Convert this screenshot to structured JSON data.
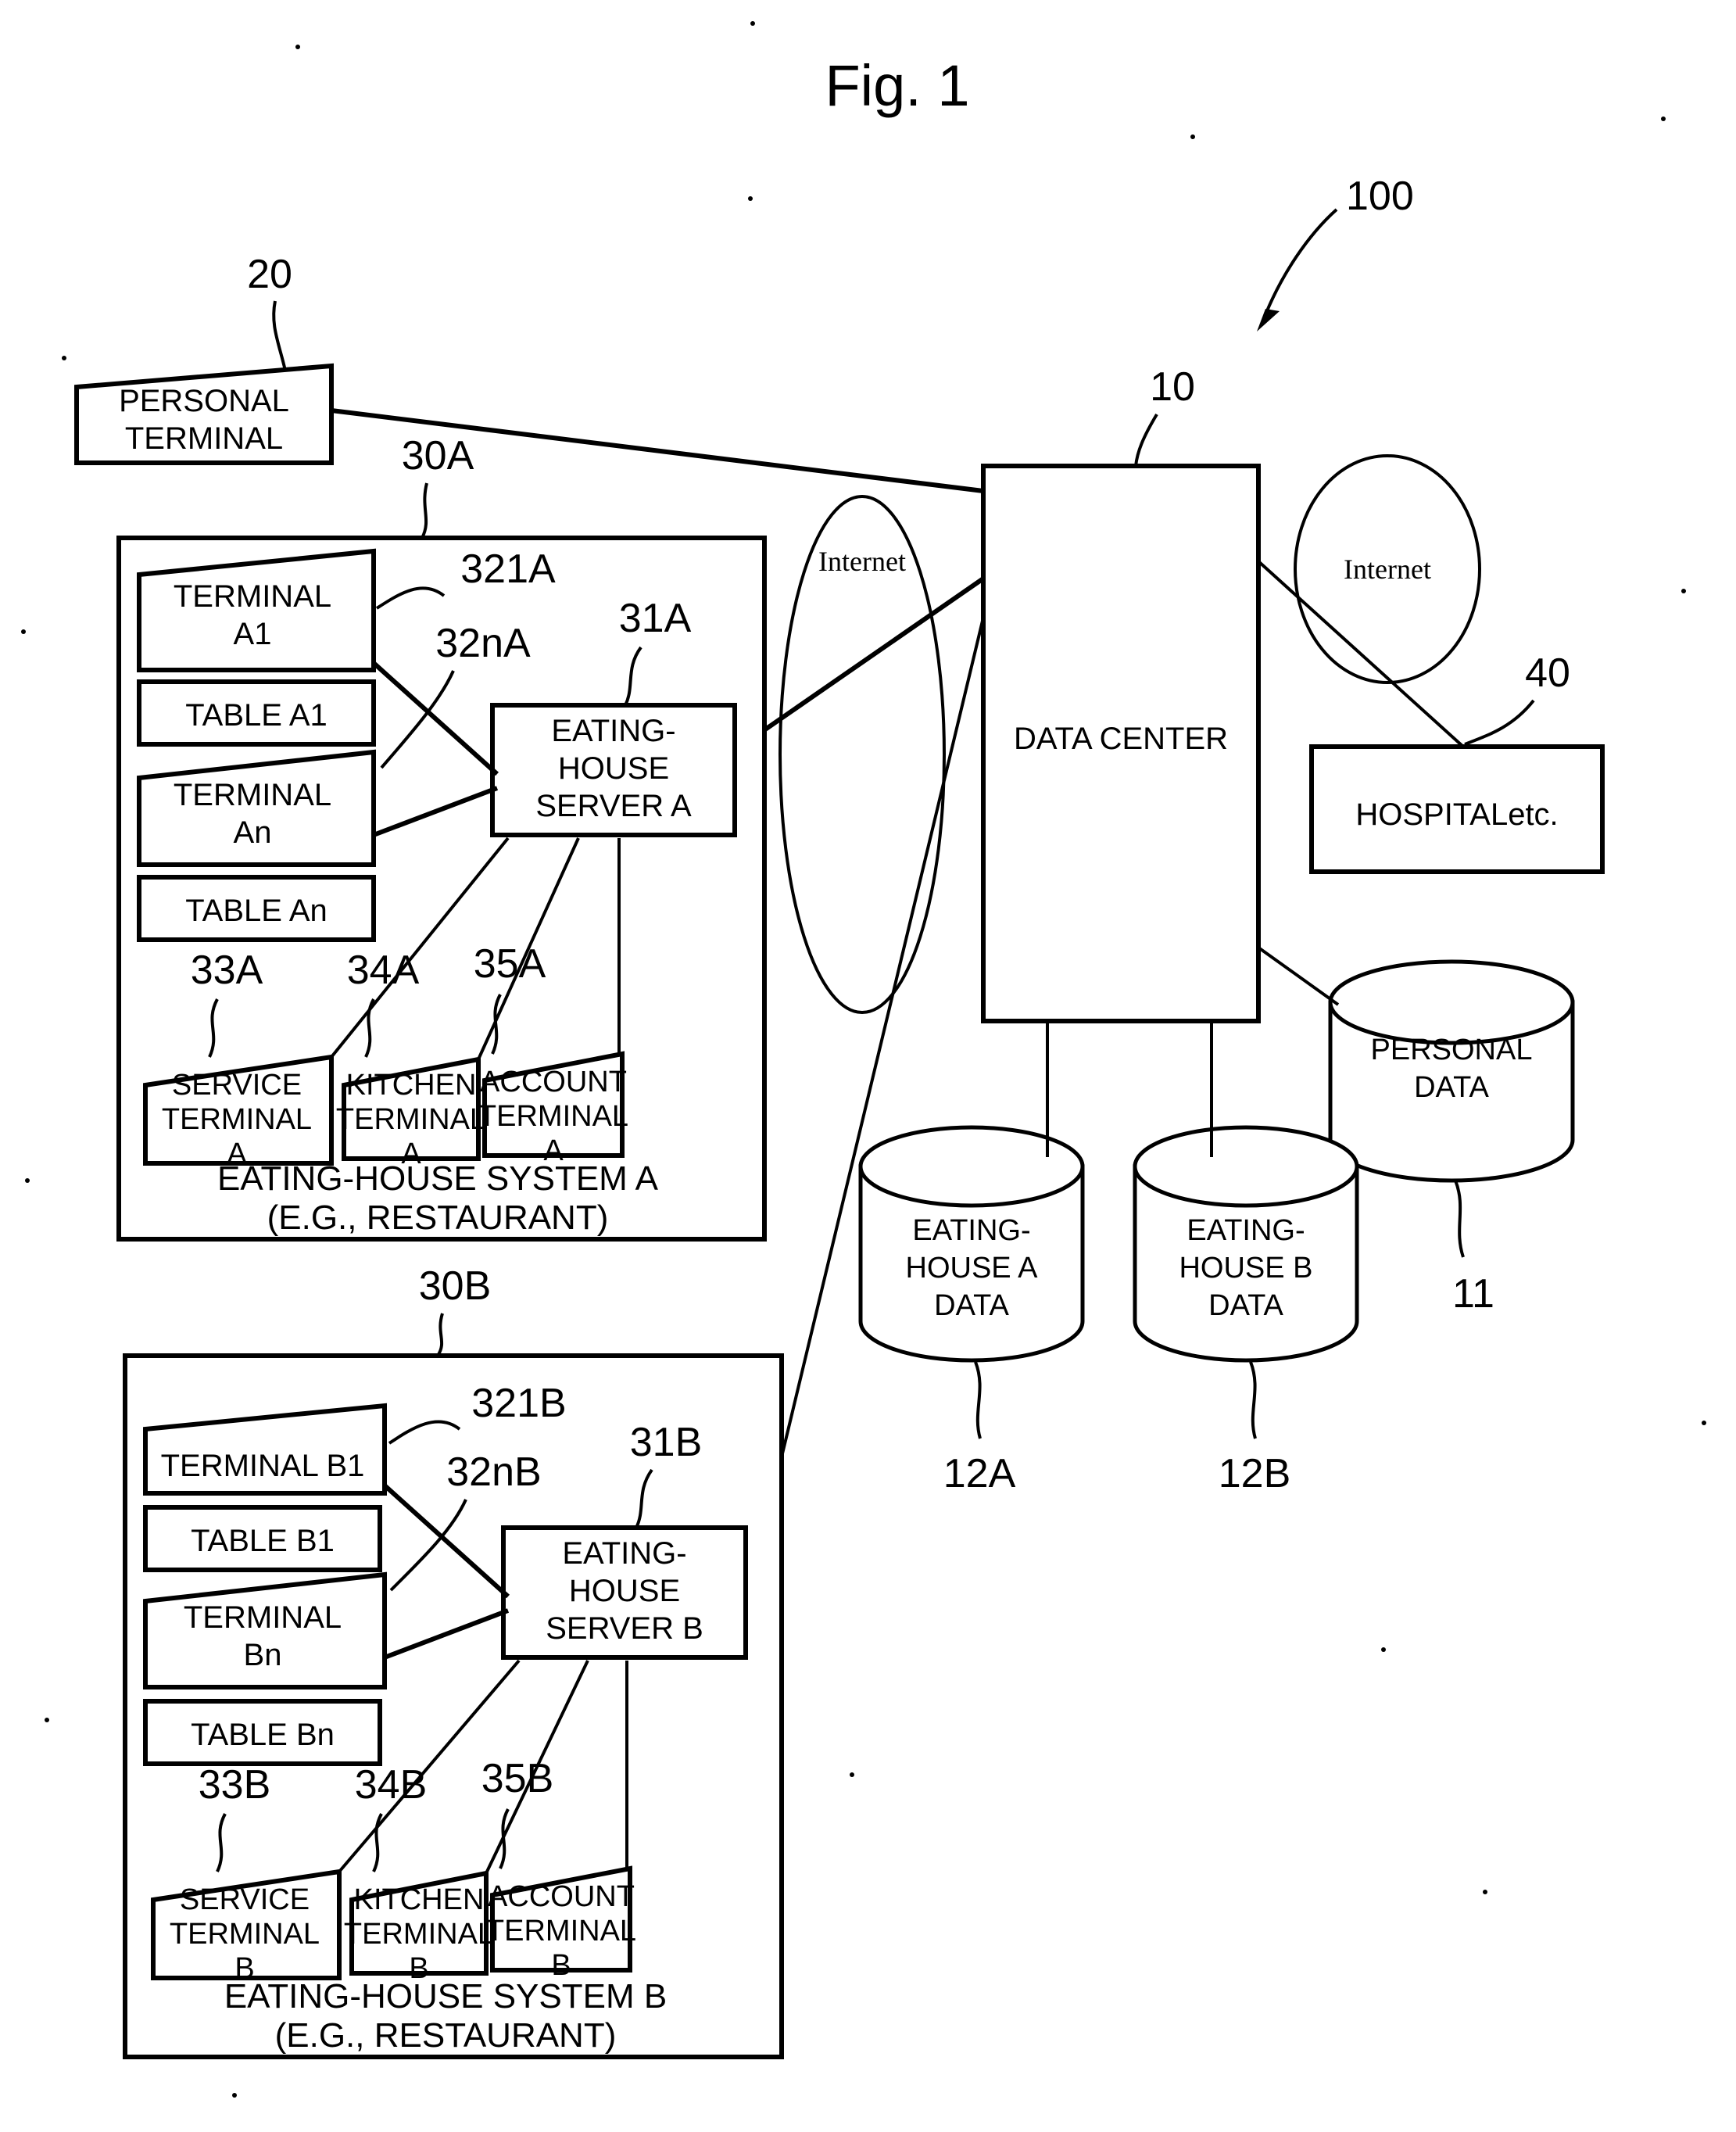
{
  "figure": {
    "title": "Fig. 1",
    "system_ref": "100"
  },
  "nodes": {
    "personal_terminal": {
      "ref": "20",
      "line1": "PERSONAL",
      "line2": "TERMINAL"
    },
    "data_center": {
      "ref": "10",
      "label": "DATA CENTER"
    },
    "hospital": {
      "ref": "40",
      "label": "HOSPITALetc."
    },
    "internet_left": {
      "label": "Internet"
    },
    "internet_right": {
      "label": "Internet"
    },
    "personal_data": {
      "ref": "11",
      "line1": "PERSONAL",
      "line2": "DATA"
    },
    "eating_house_a_data": {
      "ref": "12A",
      "line1": "EATING-",
      "line2": "HOUSE A",
      "line3": "DATA"
    },
    "eating_house_b_data": {
      "ref": "12B",
      "line1": "EATING-",
      "line2": "HOUSE B",
      "line3": "DATA"
    }
  },
  "system_a": {
    "ref": "30A",
    "caption_line1": "EATING-HOUSE SYSTEM A",
    "caption_line2": "(E.G., RESTAURANT)",
    "terminal1": {
      "ref": "321A",
      "line1": "TERMINAL",
      "line2": "A1"
    },
    "table1": {
      "label": "TABLE A1"
    },
    "terminaln": {
      "ref": "32nA",
      "line1": "TERMINAL",
      "line2": "An"
    },
    "tablen": {
      "label": "TABLE An"
    },
    "server": {
      "ref": "31A",
      "line1": "EATING-",
      "line2": "HOUSE",
      "line3": "SERVER A"
    },
    "service_terminal": {
      "ref": "33A",
      "line1": "SERVICE",
      "line2": "TERMINAL",
      "line3": "A"
    },
    "kitchen_terminal": {
      "ref": "34A",
      "line1": "KITCHEN",
      "line2": "TERMINAL",
      "line3": "A"
    },
    "account_terminal": {
      "ref": "35A",
      "line1": "ACCOUNT",
      "line2": "TERMINAL",
      "line3": "A"
    }
  },
  "system_b": {
    "ref": "30B",
    "caption_line1": "EATING-HOUSE SYSTEM B",
    "caption_line2": "(E.G., RESTAURANT)",
    "terminal1": {
      "ref": "321B",
      "label": "TERMINAL B1"
    },
    "table1": {
      "label": "TABLE B1"
    },
    "terminaln": {
      "ref": "32nB",
      "line1": "TERMINAL",
      "line2": "Bn"
    },
    "tablen": {
      "label": "TABLE Bn"
    },
    "server": {
      "ref": "31B",
      "line1": "EATING-",
      "line2": "HOUSE",
      "line3": "SERVER B"
    },
    "service_terminal": {
      "ref": "33B",
      "line1": "SERVICE",
      "line2": "TERMINAL",
      "line3": "B"
    },
    "kitchen_terminal": {
      "ref": "34B",
      "line1": "KITCHEN",
      "line2": "TERMINAL",
      "line3": "B"
    },
    "account_terminal": {
      "ref": "35B",
      "line1": "ACCOUNT",
      "line2": "TERMINAL",
      "line3": "B"
    }
  },
  "colors": {
    "ink": "#000000",
    "paper": "#ffffff"
  }
}
